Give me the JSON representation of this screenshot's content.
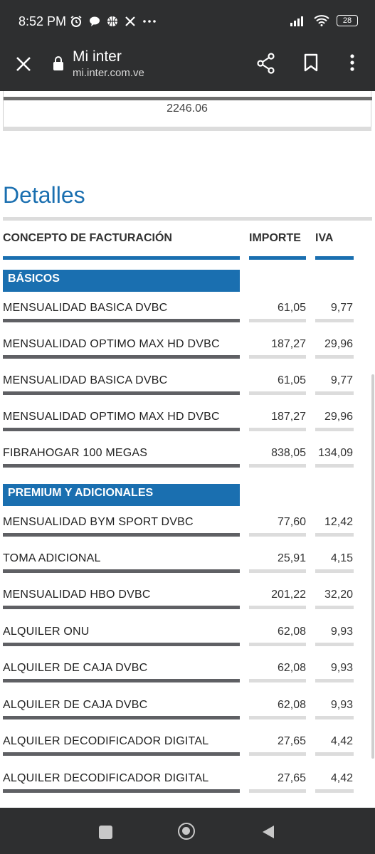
{
  "status_bar": {
    "time": "8:52 PM",
    "battery": "28",
    "icons_left": [
      "alarm-icon",
      "chat-icon",
      "basketball-icon",
      "x-icon",
      "more-icon"
    ],
    "icons_right": [
      "signal-icon",
      "wifi-icon",
      "battery-icon"
    ]
  },
  "toolbar": {
    "title": "Mi inter",
    "url": "mi.inter.com.ve"
  },
  "top_total": "2246.06",
  "details": {
    "title": "Detalles",
    "headers": {
      "concept": "CONCEPTO DE FACTURACIÓN",
      "amount": "IMPORTE",
      "iva": "IVA"
    },
    "sections": [
      {
        "name": "BÁSICOS",
        "rows": [
          {
            "concept": "MENSUALIDAD BASICA DVBC",
            "amount": "61,05",
            "iva": "9,77"
          },
          {
            "concept": "MENSUALIDAD OPTIMO MAX HD DVBC",
            "amount": "187,27",
            "iva": "29,96"
          },
          {
            "concept": "MENSUALIDAD BASICA DVBC",
            "amount": "61,05",
            "iva": "9,77"
          },
          {
            "concept": "MENSUALIDAD OPTIMO MAX HD DVBC",
            "amount": "187,27",
            "iva": "29,96"
          },
          {
            "concept": "FIBRAHOGAR 100 MEGAS",
            "amount": "838,05",
            "iva": "134,09"
          }
        ]
      },
      {
        "name": "PREMIUM Y ADICIONALES",
        "rows": [
          {
            "concept": "MENSUALIDAD BYM SPORT DVBC",
            "amount": "77,60",
            "iva": "12,42"
          },
          {
            "concept": "TOMA ADICIONAL",
            "amount": "25,91",
            "iva": "4,15"
          },
          {
            "concept": "MENSUALIDAD HBO DVBC",
            "amount": "201,22",
            "iva": "32,20"
          },
          {
            "concept": "ALQUILER ONU",
            "amount": "62,08",
            "iva": "9,93"
          },
          {
            "concept": "ALQUILER DE CAJA DVBC",
            "amount": "62,08",
            "iva": "9,93"
          },
          {
            "concept": "ALQUILER DE CAJA DVBC",
            "amount": "62,08",
            "iva": "9,93"
          },
          {
            "concept": "ALQUILER DECODIFICADOR DIGITAL",
            "amount": "27,65",
            "iva": "4,42"
          },
          {
            "concept": "ALQUILER DECODIFICADOR DIGITAL",
            "amount": "27,65",
            "iva": "4,42"
          }
        ]
      }
    ]
  }
}
